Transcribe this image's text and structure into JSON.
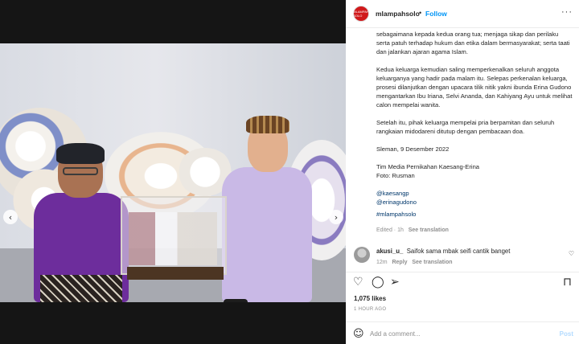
{
  "post": {
    "username": "mlampahsolo",
    "separator": "•",
    "follow_label": "Follow",
    "more_label": "···",
    "avatar_text": "MLAMPAH SOLO"
  },
  "caption": {
    "paragraphs": [
      "sebagaimana kepada kedua orang tua; menjaga sikap dan perilaku serta patuh terhadap hukum dan etika dalam bermasyarakat; serta taati dan jalankan ajaran agama Islam.",
      "Kedua keluarga kemudian saling memperkenalkan seluruh anggota keluarganya yang hadir pada malam itu. Selepas perkenalan keluarga, prosesi dilanjutkan dengan upacara tilik nitik yakni ibunda Erina Gudono mengantarkan Ibu Iriana, Selvi Ananda, dan Kahiyang Ayu untuk melihat calon mempelai wanita.",
      "Setelah itu, pihak keluarga mempelai pria berpamitan dan seluruh rangkaian midodareni ditutup dengan pembacaan doa.",
      "Sleman, 9 Desember 2022"
    ],
    "credit_line1": "Tim Media Pernikahan Kaesang-Erina",
    "credit_line2": "Foto: Rusman",
    "mention1": "@kaesangp",
    "mention2": "@erinagudono",
    "hashtag": "#mlampahsolo",
    "edited": "Edited · 1h",
    "see_translation": "See translation"
  },
  "comment": {
    "username": "akusi_u_",
    "text": "Saifok sama mbak seifi cantik banget",
    "time": "12m",
    "reply": "Reply",
    "see_translation": "See translation",
    "heart": "♡"
  },
  "actions": {
    "like_icon": "♡",
    "comment_icon": "◯",
    "share_icon": "➢",
    "save_icon": "⊓"
  },
  "stats": {
    "likes": "1,075 likes",
    "time_ago": "1 HOUR AGO"
  },
  "add_comment": {
    "emoji": "☺",
    "placeholder": "Add a comment...",
    "post_label": "Post"
  },
  "carousel": {
    "prev": "‹",
    "next": "›",
    "slides": 6,
    "active": 0
  }
}
